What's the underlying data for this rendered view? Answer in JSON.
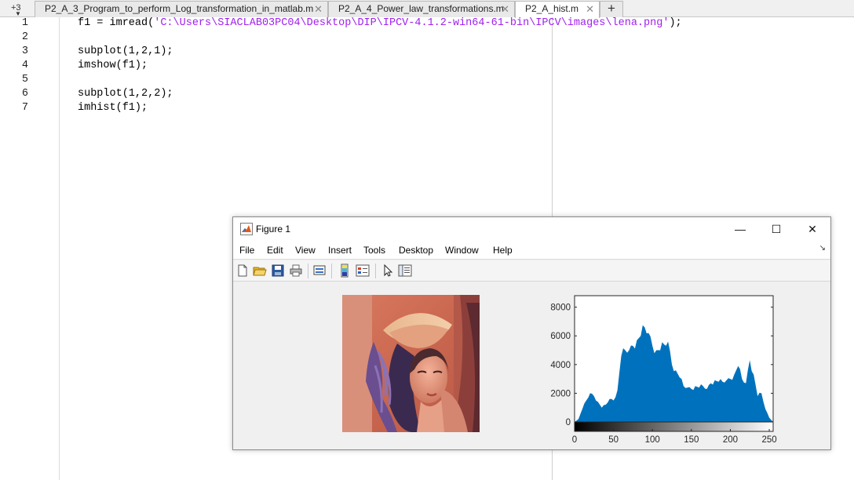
{
  "editor": {
    "tabs_overflow_label": "+3",
    "tabs": [
      {
        "label": "P2_A_3_Program_to_perform_Log_transformation_in_matlab.m",
        "close": "✕",
        "active": false
      },
      {
        "label": "P2_A_4_Power_law_transformations.m",
        "close": "✕",
        "active": false
      },
      {
        "label": "P2_A_hist.m",
        "close": "✕",
        "active": true
      }
    ],
    "add_tab_label": "+",
    "lines": [
      {
        "num": "1",
        "code": "f1 = imread(",
        "str": "'C:\\Users\\SIACLAB03PC04\\Desktop\\DIP\\IPCV-4.1.2-win64-61-bin\\IPCV\\images\\lena.png'",
        "tail": ");"
      },
      {
        "num": "2",
        "code": "",
        "str": "",
        "tail": ""
      },
      {
        "num": "3",
        "code": "subplot(1,2,1);",
        "str": "",
        "tail": ""
      },
      {
        "num": "4",
        "code": "imshow(f1);",
        "str": "",
        "tail": ""
      },
      {
        "num": "5",
        "code": "",
        "str": "",
        "tail": ""
      },
      {
        "num": "6",
        "code": "subplot(1,2,2);",
        "str": "",
        "tail": ""
      },
      {
        "num": "7",
        "code": "imhist(f1);",
        "str": "",
        "tail": ""
      }
    ]
  },
  "figure": {
    "title": "Figure 1",
    "window_buttons": {
      "minimize": "—",
      "maximize": "☐",
      "close": "✕"
    },
    "menu": [
      "File",
      "Edit",
      "View",
      "Insert",
      "Tools",
      "Desktop",
      "Window",
      "Help"
    ],
    "dock_glyph": "↘",
    "toolbar_icons": [
      "new-figure-icon",
      "open-file-icon",
      "save-icon",
      "print-icon",
      "link-plot-icon",
      "insert-colorbar-icon",
      "insert-legend-icon",
      "edit-plot-arrow-icon",
      "property-inspector-icon"
    ]
  },
  "chart_data": {
    "type": "area",
    "title": "",
    "xlabel": "",
    "ylabel": "",
    "xlim": [
      0,
      255
    ],
    "ylim": [
      0,
      8800
    ],
    "xticks": [
      0,
      50,
      100,
      150,
      200,
      250
    ],
    "yticks": [
      0,
      2000,
      4000,
      6000,
      8000
    ],
    "series_color": "#0072bd",
    "x": [
      0,
      5,
      10,
      15,
      20,
      25,
      30,
      35,
      40,
      45,
      50,
      55,
      60,
      65,
      70,
      75,
      80,
      85,
      90,
      95,
      100,
      105,
      110,
      115,
      120,
      125,
      130,
      135,
      140,
      145,
      150,
      155,
      160,
      165,
      170,
      175,
      180,
      185,
      190,
      195,
      200,
      205,
      210,
      215,
      220,
      225,
      230,
      235,
      240,
      245,
      250,
      255
    ],
    "y": [
      0,
      200,
      900,
      1500,
      2000,
      1800,
      1400,
      1000,
      1200,
      1600,
      1500,
      2200,
      4600,
      5000,
      5000,
      5300,
      5700,
      6000,
      6600,
      6200,
      5300,
      5000,
      5000,
      5400,
      5600,
      4000,
      3600,
      3100,
      2500,
      2400,
      2300,
      2500,
      2400,
      2500,
      2300,
      2700,
      2900,
      2800,
      2800,
      2900,
      3000,
      3300,
      3900,
      3000,
      2700,
      4300,
      3300,
      1800,
      2000,
      900,
      300,
      0
    ]
  }
}
